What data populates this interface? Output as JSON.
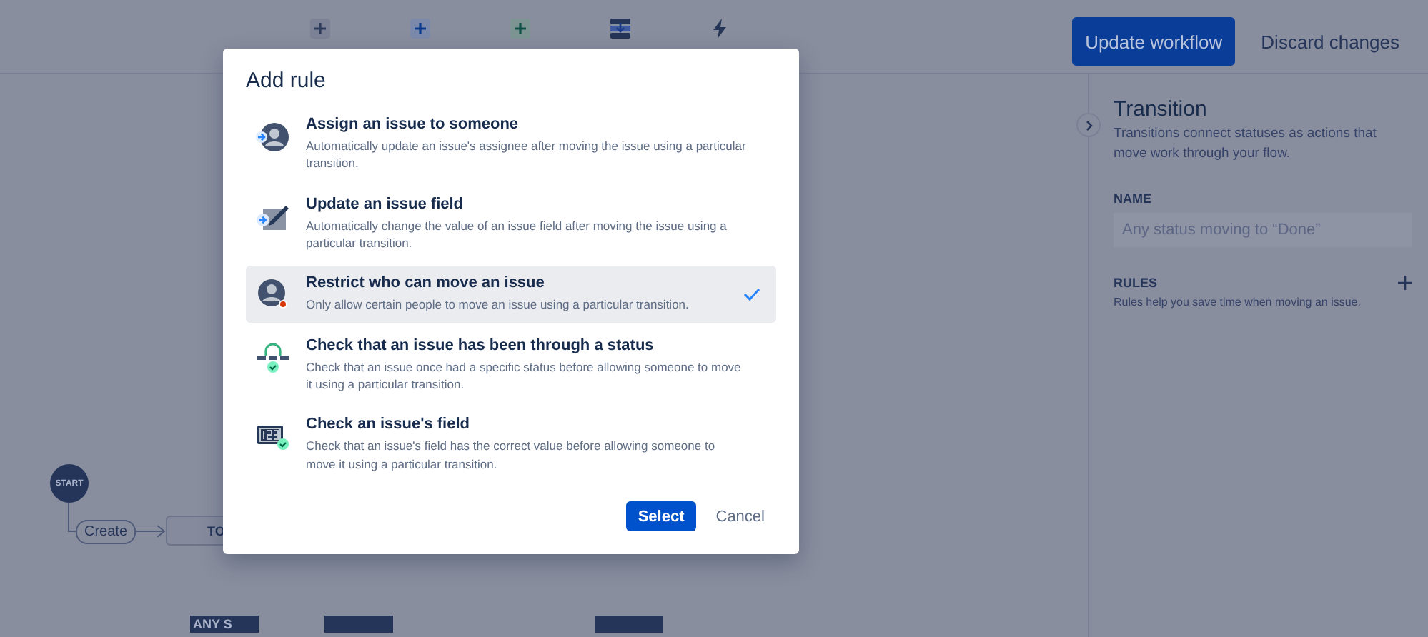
{
  "toolbar": {
    "items": [
      {
        "kind": "todo"
      },
      {
        "kind": "inprogress"
      },
      {
        "kind": "done"
      },
      {
        "kind": "transition"
      },
      {
        "kind": "rule"
      }
    ],
    "primary_button": "Update workflow",
    "secondary_button": "Discard changes"
  },
  "canvas": {
    "start": "START",
    "transition": "Create",
    "status": "TO",
    "any_status": "ANY S"
  },
  "panel": {
    "title": "Transition",
    "description": "Transitions connect statuses as actions that move work through your flow.",
    "name_label": "NAME",
    "name_placeholder": "Any status moving to “Done”",
    "rules_label": "RULES",
    "rules_hint": "Rules help you save time when moving an issue."
  },
  "dialog": {
    "title": "Add rule",
    "options": [
      {
        "kind": "assign",
        "title": "Assign an issue to someone",
        "description": "Automatically update an issue's assignee after moving the issue using a particular transition.",
        "selected": false
      },
      {
        "kind": "field",
        "title": "Update an issue field",
        "description": "Automatically change the value of an issue field after moving the issue using a particular transition.",
        "selected": false
      },
      {
        "kind": "restrict",
        "title": "Restrict who can move an issue",
        "description": "Only allow certain people to move an issue using a particular transition.",
        "selected": true
      },
      {
        "kind": "status",
        "title": "Check that an issue has been through a status",
        "description": "Check that an issue once had a specific status before allowing someone to move it using a particular transition.",
        "selected": false
      },
      {
        "kind": "checkfield",
        "title": "Check an issue's field",
        "description": "Check that an issue's field has the correct value before allowing someone to move it using a particular transition.",
        "selected": false
      }
    ],
    "select_button": "Select",
    "cancel_button": "Cancel"
  }
}
